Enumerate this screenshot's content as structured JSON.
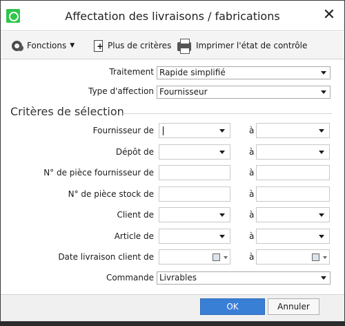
{
  "window": {
    "title": "Affectation des livraisons / fabrications"
  },
  "toolbar": {
    "fonctions_label": "Fonctions",
    "plus_criteres_label": "Plus de critères",
    "imprimer_label": "Imprimer l'état de contrôle"
  },
  "form": {
    "traitement": {
      "label": "Traitement",
      "value": "Rapide simplifié"
    },
    "type_affection": {
      "label": "Type d'affection",
      "value": "Fournisseur"
    },
    "section_title": "Critères de sélection",
    "range_separator": "à",
    "rows": [
      {
        "label": "Fournisseur de",
        "from": "",
        "to": ""
      },
      {
        "label": "Dépôt de",
        "from": "",
        "to": ""
      },
      {
        "label": "N° de pièce fournisseur de",
        "from": "",
        "to": ""
      },
      {
        "label": "N° de pièce stock de",
        "from": "",
        "to": ""
      },
      {
        "label": "Client de",
        "from": "",
        "to": ""
      },
      {
        "label": "Article de",
        "from": "",
        "to": ""
      },
      {
        "label": "Date livraison client de",
        "from": "",
        "to": ""
      }
    ],
    "commande": {
      "label": "Commande",
      "value": "Livrables"
    }
  },
  "footer": {
    "ok_label": "OK",
    "cancel_label": "Annuler"
  }
}
